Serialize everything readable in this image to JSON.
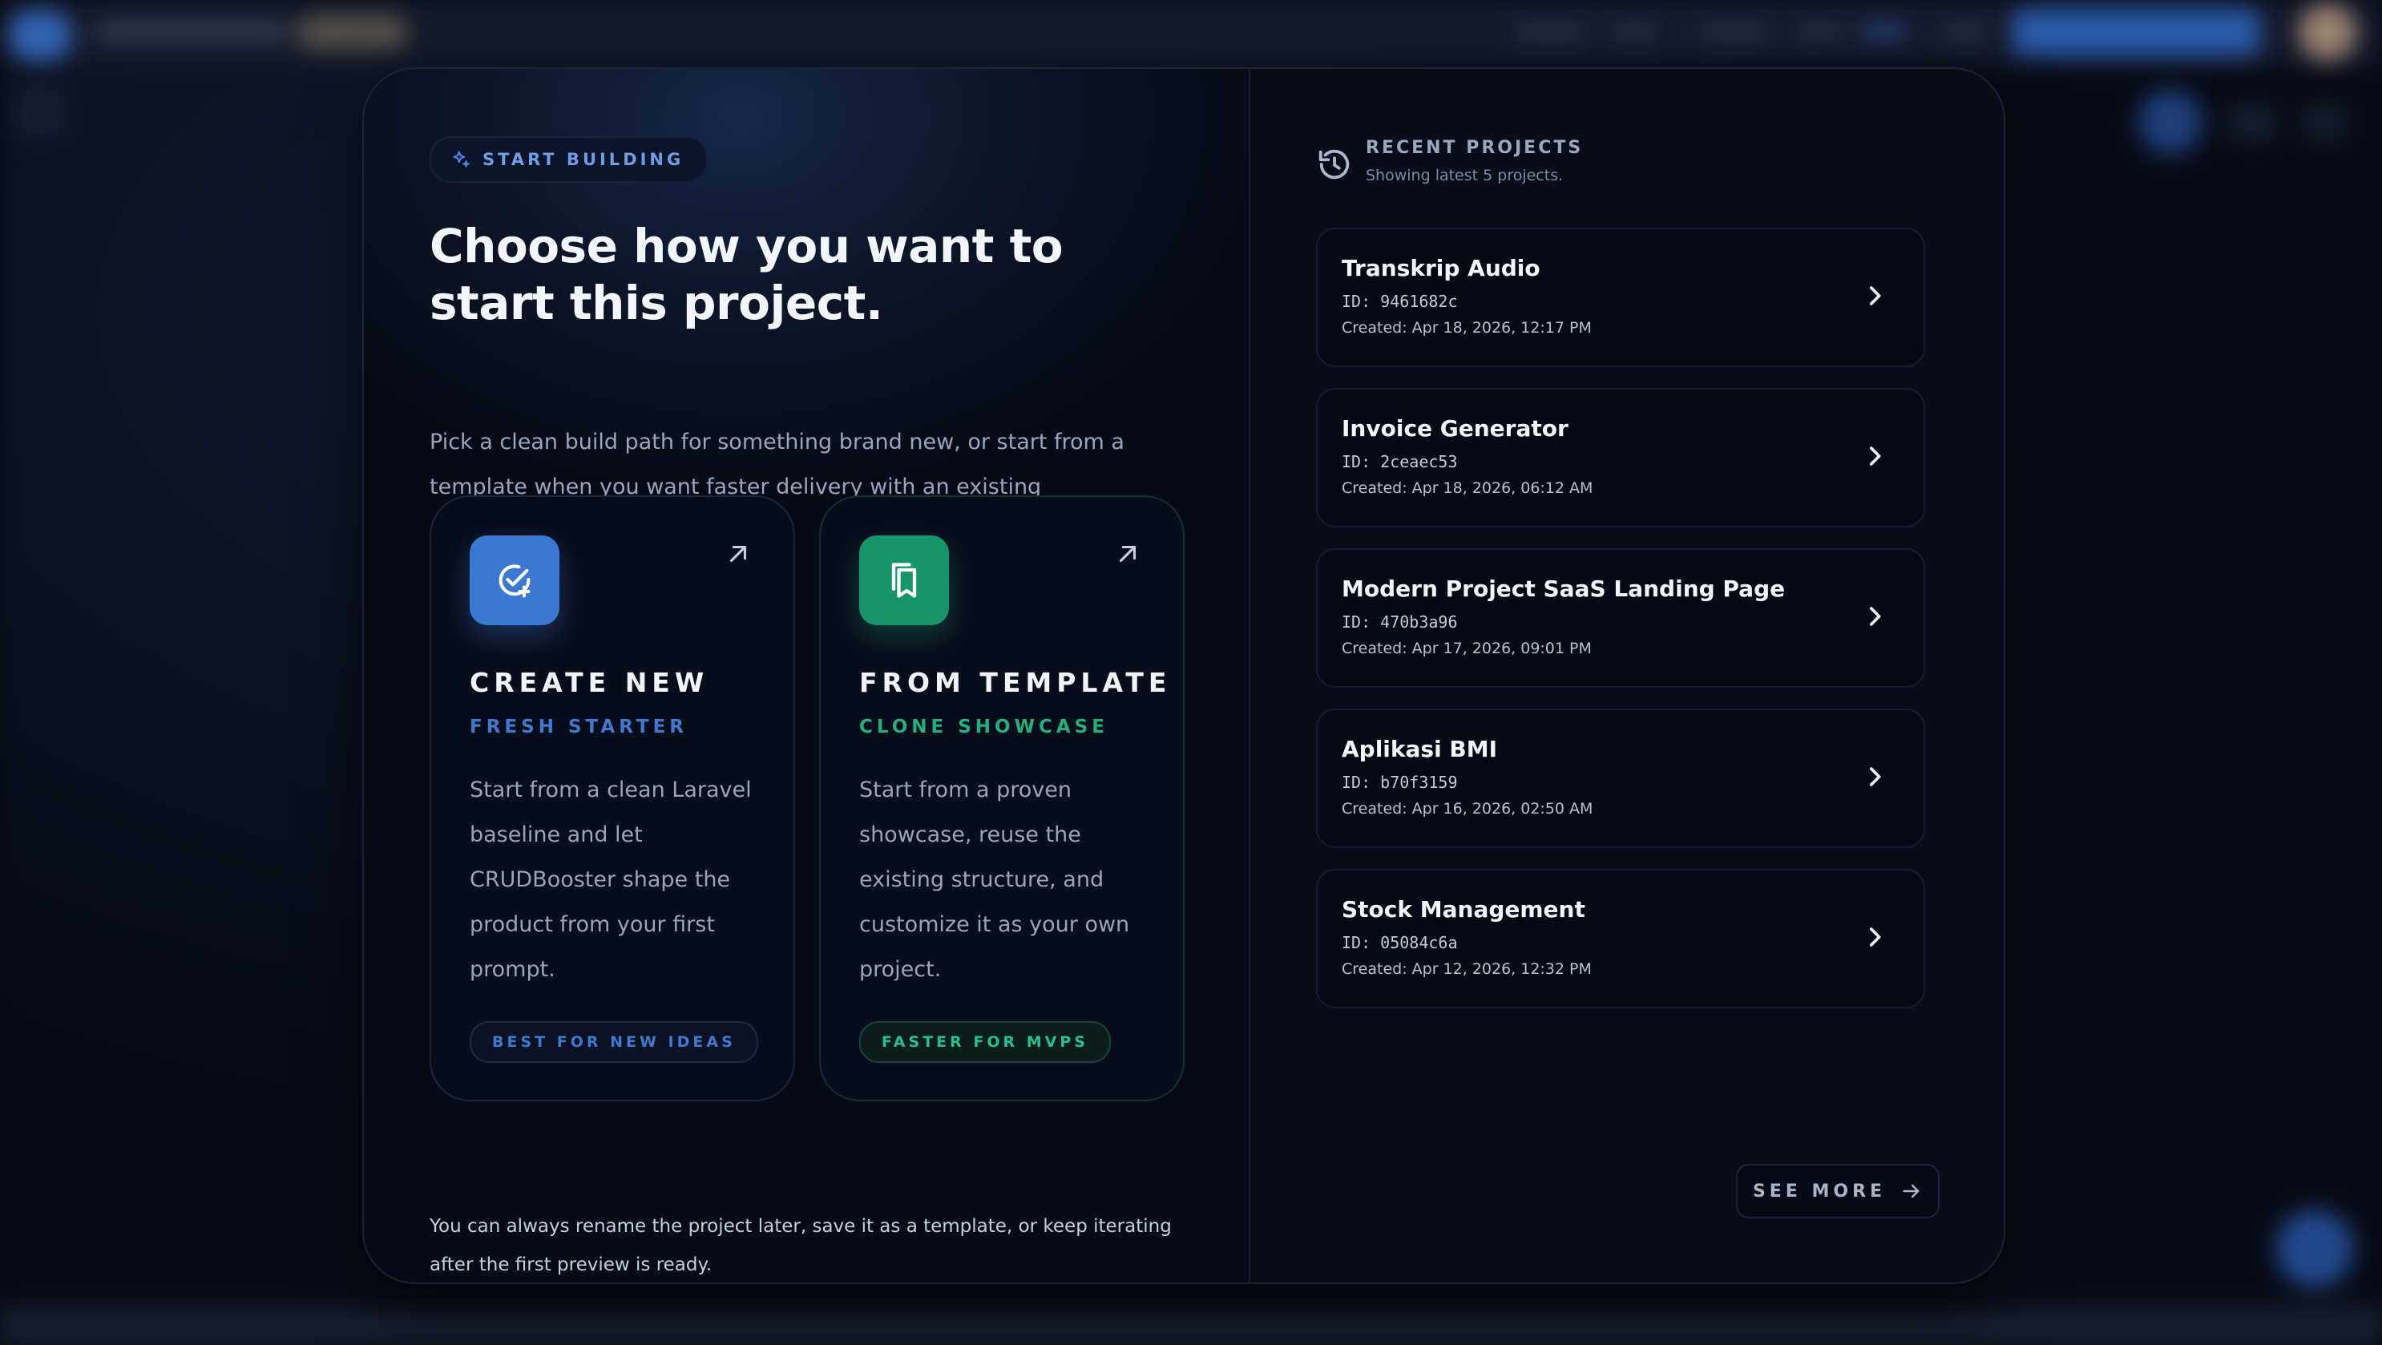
{
  "badge": {
    "label": "START BUILDING",
    "icon": "sparkle-icon"
  },
  "headline": "Choose how you want to start this project.",
  "intro": "Pick a clean build path for something brand new, or start from a template when you want faster delivery with an existing structure.",
  "options": [
    {
      "title": "CREATE NEW",
      "subtitle": "FRESH STARTER",
      "description": "Start from a clean Laravel baseline and let CRUDBooster shape the product from your first prompt.",
      "tag": "BEST FOR NEW IDEAS",
      "icon": "check-plus-icon",
      "accent": "#3b78d2"
    },
    {
      "title": "FROM TEMPLATE",
      "subtitle": "CLONE SHOWCASE",
      "description": "Start from a proven showcase, reuse the existing structure, and customize it as your own project.",
      "tag": "FASTER FOR MVPS",
      "icon": "bookmark-copy-icon",
      "accent": "#16956a"
    }
  ],
  "footnote": "You can always rename the project later, save it as a template, or keep iterating after the first preview is ready.",
  "recent": {
    "title": "RECENT PROJECTS",
    "subtitle": "Showing latest 5 projects.",
    "icon": "history-icon",
    "projects": [
      {
        "name": "Transkrip Audio",
        "id": "ID: 9461682c",
        "created": "Created: Apr 18, 2026, 12:17 PM"
      },
      {
        "name": "Invoice Generator",
        "id": "ID: 2ceaec53",
        "created": "Created: Apr 18, 2026, 06:12 AM"
      },
      {
        "name": "Modern Project SaaS Landing Page",
        "id": "ID: 470b3a96",
        "created": "Created: Apr 17, 2026, 09:01 PM"
      },
      {
        "name": "Aplikasi BMI",
        "id": "ID: b70f3159",
        "created": "Created: Apr 16, 2026, 02:50 AM"
      },
      {
        "name": "Stock Management",
        "id": "ID: 05084c6a",
        "created": "Created: Apr 12, 2026, 12:32 PM"
      }
    ],
    "see_more": "SEE MORE"
  }
}
